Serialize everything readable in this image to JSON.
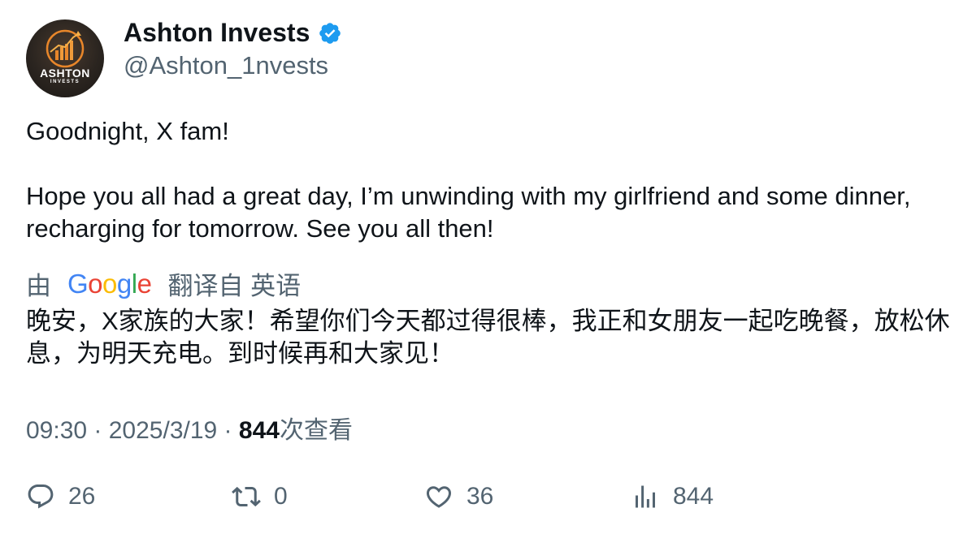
{
  "author": {
    "avatar_text": "ASHTON",
    "avatar_subtext": "INVESTS",
    "display_name": "Ashton Invests",
    "handle": "@Ashton_1nvests",
    "verified": true
  },
  "tweet": {
    "paragraphs": [
      "Goodnight, X fam!",
      "Hope you all had a great day, I’m unwinding with my girlfriend and some dinner, recharging for tomorrow. See you all then!"
    ]
  },
  "translation": {
    "prefix": "由",
    "provider": "Google",
    "suffix": "翻译自 英语",
    "text": "晚安，X家族的大家！希望你们今天都过得很棒，我正和女朋友一起吃晚餐，放松休息，为明天充电。到时候再和大家见！"
  },
  "meta": {
    "time": "09:30",
    "separator": " · ",
    "date": "2025/3/19",
    "views_count": "844",
    "views_label": "次查看"
  },
  "actions": {
    "reply_count": "26",
    "retweet_count": "0",
    "like_count": "36",
    "views_count": "844"
  },
  "colors": {
    "text_primary": "#0f1419",
    "text_secondary": "#536471",
    "verified_blue": "#1d9bf0",
    "google_blue": "#4285f4",
    "google_red": "#ea4335",
    "google_yellow": "#fbbc05",
    "google_green": "#34a853"
  }
}
